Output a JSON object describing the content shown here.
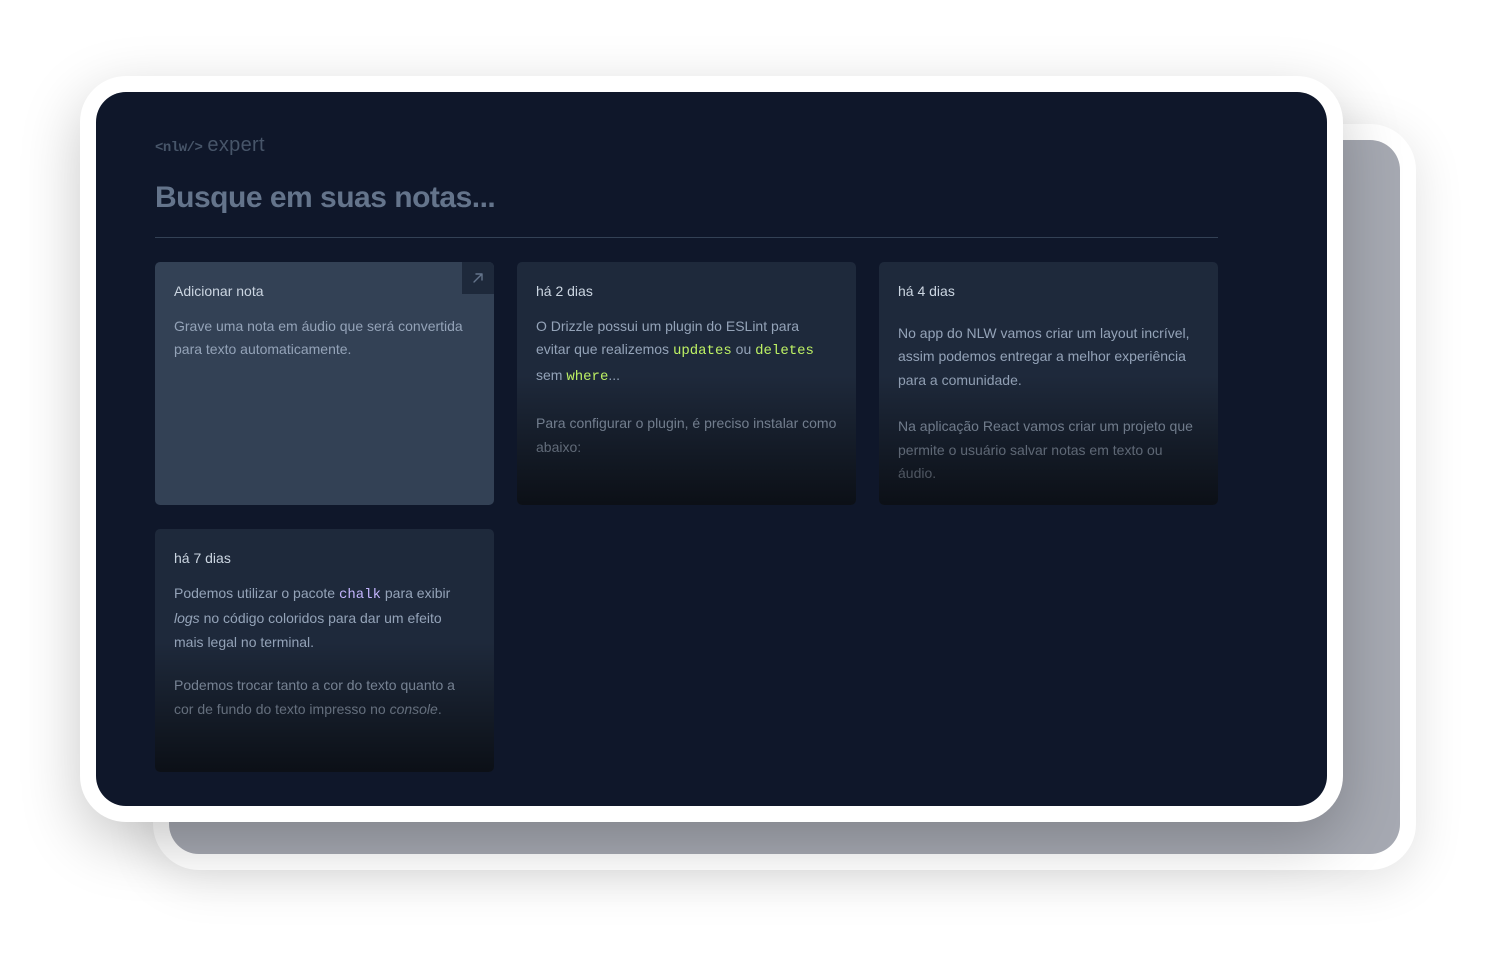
{
  "logo": {
    "tag": "<nlw/>",
    "word": "expert"
  },
  "search": {
    "placeholder": "Busque em suas notas..."
  },
  "add_card": {
    "title": "Adicionar nota",
    "description": "Grave uma nota em áudio que será convertida para texto automaticamente.",
    "icon": "arrow-up-right-icon"
  },
  "notes": [
    {
      "date": "há 2 dias",
      "p1": {
        "a": "O Drizzle possui um plugin do ESLint para evitar que realizemos ",
        "code1": "updates",
        "b": " ou ",
        "code2": "deletes",
        "c": " sem ",
        "code3": "where",
        "d": "..."
      },
      "p2": "Para configurar o plugin, é preciso instalar como abaixo:"
    },
    {
      "date": "há 4 dias",
      "p1": "No app do NLW vamos criar um layout incrível, assim podemos entregar a melhor experiência para a comunidade.",
      "p2": "Na aplicação React vamos criar um projeto que permite o usuário salvar notas em texto ou áudio."
    },
    {
      "date": "há 7 dias",
      "p1": {
        "a": "Podemos utilizar o pacote ",
        "code": "chalk",
        "b": " para exibir ",
        "em": "logs",
        "c": " no código coloridos para dar um efeito mais legal no terminal."
      },
      "p2": {
        "a": "Podemos trocar tanto a cor do texto quanto a cor de fundo do texto impresso no ",
        "em": "console",
        "b": "."
      }
    }
  ],
  "colors": {
    "background": "#0f172a",
    "card": "#1e293b",
    "card_add": "#334155",
    "code_lime": "#bef264",
    "code_violet": "#c4b5fd"
  }
}
